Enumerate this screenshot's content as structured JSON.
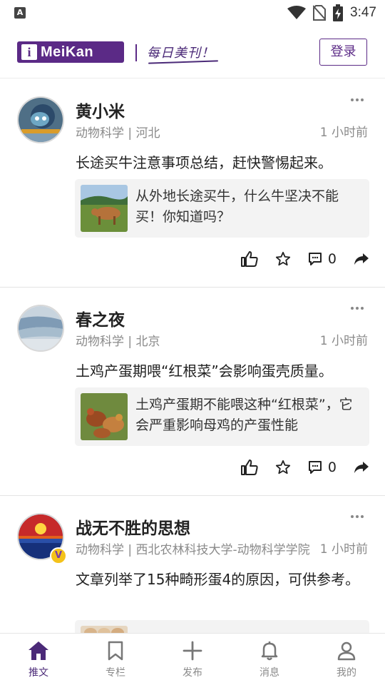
{
  "status_bar": {
    "time": "3:47",
    "app_icon_letter": "A"
  },
  "header": {
    "logo_text": "MeiKan",
    "logo_letter": "i",
    "slogan": "每日美刊！",
    "login_label": "登录",
    "brand_color": "#5b2a86"
  },
  "posts": [
    {
      "username": "黄小米",
      "meta": "动物科学 | 河北",
      "time": "1 小时前",
      "content": "长途买牛注意事项总结，赶快警惕起来。",
      "card_text": "从外地长途买牛，什么牛坚决不能买！你知道吗？",
      "comment_count": "0",
      "verified": false
    },
    {
      "username": "春之夜",
      "meta": "动物科学 | 北京",
      "time": "1 小时前",
      "content": "土鸡产蛋期喂“红根菜”会影响蛋壳质量。",
      "card_text": "土鸡产蛋期不能喂这种“红根菜”，它会严重影响母鸡的产蛋性能",
      "comment_count": "0",
      "verified": false
    },
    {
      "username": "战无不胜的思想",
      "meta": "动物科学 | 西北农林科技大学-动物科学学院",
      "time": "1 小时前",
      "content": "文章列举了15种畸形蛋4的原因，可供参考。",
      "verified": true,
      "badge_letter": "V"
    }
  ],
  "bottom_nav": {
    "items": [
      {
        "label": "推文",
        "icon": "home-icon",
        "active": true
      },
      {
        "label": "专栏",
        "icon": "bookmark-icon",
        "active": false
      },
      {
        "label": "发布",
        "icon": "plus-icon",
        "active": false
      },
      {
        "label": "消息",
        "icon": "bell-icon",
        "active": false
      },
      {
        "label": "我的",
        "icon": "user-icon",
        "active": false
      }
    ]
  }
}
